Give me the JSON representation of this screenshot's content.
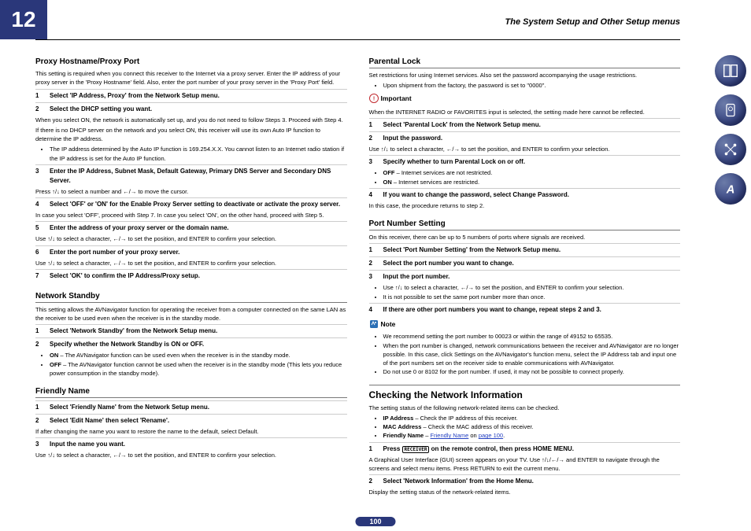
{
  "chapter_number": "12",
  "breadcrumb": "The System Setup and Other Setup menus",
  "page_number": "100",
  "left": {
    "proxy": {
      "title": "Proxy Hostname/Proxy Port",
      "intro": "This setting is required when you connect this receiver to the Internet via a proxy server. Enter the IP address of your proxy server in the 'Proxy Hostname' field. Also, enter the port number of your proxy server in the 'Proxy Port' field.",
      "s1": "Select 'IP Address, Proxy' from the Network Setup menu.",
      "s2": "Select the DHCP setting you want.",
      "s2n1": "When you select ON, the network is automatically set up, and you do not need to follow Steps 3. Proceed with Step 4.",
      "s2n2": "If there is no DHCP server on the network and you select ON, this receiver will use its own Auto IP function to determine the IP address.",
      "s2b": "The IP address determined by the Auto IP function is 169.254.X.X. You cannot listen to an Internet radio station if the IP address is set for the Auto IP function.",
      "s3": "Enter the IP Address, Subnet Mask, Default Gateway, Primary DNS Server and Secondary DNS Server.",
      "s3n": "Press ↑/↓ to select a number and ←/→ to move the cursor.",
      "s4": "Select 'OFF' or 'ON' for the Enable Proxy Server setting to deactivate or activate the proxy server.",
      "s4n": "In case you select 'OFF', proceed with Step 7. In case you select 'ON', on the other hand, proceed with Step 5.",
      "s5": "Enter the address of your proxy server or the domain name.",
      "s5n": "Use ↑/↓ to select a character, ←/→ to set the position, and ENTER to confirm your selection.",
      "s6": "Enter the port number of your proxy server.",
      "s6n": "Use ↑/↓ to select a character, ←/→ to set the position, and ENTER to confirm your selection.",
      "s7": "Select 'OK' to confirm the IP Address/Proxy setup."
    },
    "standby": {
      "title": "Network Standby",
      "intro": "This setting allows the AVNavigator function for operating the receiver from a computer connected on the same LAN as the receiver to be used even when the receiver is in the standby mode.",
      "s1": "Select 'Network Standby' from the Network Setup menu.",
      "s2": "Specify whether the Network Standby is ON or OFF.",
      "b1_label": "ON",
      "b1_text": " – The AVNavigator function can be used even when the receiver is in the standby mode.",
      "b2_label": "OFF",
      "b2_text": " – The AVNavigator function cannot be used when the receiver is in the standby mode (This lets you reduce power consumption in the standby mode)."
    },
    "friendly": {
      "title": "Friendly Name",
      "s1": "Select 'Friendly Name' from the Network Setup menu.",
      "s2": "Select 'Edit Name' then select 'Rename'.",
      "s2n": "If after changing the name you want to restore the name to the default, select Default.",
      "s3": "Input the name you want.",
      "s3n": "Use ↑/↓ to select a character, ←/→ to set the position, and ENTER to confirm your selection."
    }
  },
  "right": {
    "parental": {
      "title": "Parental Lock",
      "intro": "Set restrictions for using Internet services. Also set the password accompanying the usage restrictions.",
      "b0": "Upon shipment from the factory, the password is set to \"0000\".",
      "imp_label": "Important",
      "imp_text": "When the INTERNET RADIO or FAVORITES input is selected, the setting made here cannot be reflected.",
      "s1": "Select 'Parental Lock' from the Network Setup menu.",
      "s2": "Input the password.",
      "s2n": "Use ↑/↓ to select a character, ←/→ to set the position, and ENTER to confirm your selection.",
      "s3": "Specify whether to turn Parental Lock on or off.",
      "b1_label": "OFF",
      "b1_text": " – Internet services are not restricted.",
      "b2_label": "ON",
      "b2_text": " – Internet services are restricted.",
      "s4": "If you want to change the password, select Change Password.",
      "s4n": "In this case, the procedure returns to step 2."
    },
    "port": {
      "title": "Port Number Setting",
      "intro": "On this receiver, there can be up to 5 numbers of ports where signals are received.",
      "s1": "Select 'Port Number Setting' from the Network Setup menu.",
      "s2": "Select the port number you want to change.",
      "s3": "Input the port number.",
      "b3a": "Use ↑/↓ to select a character, ←/→ to set the position, and ENTER to confirm your selection.",
      "b3b": "It is not possible to set the same port number more than once.",
      "s4": "If there are other port numbers you want to change, repeat steps 2 and 3.",
      "note_label": "Note",
      "nb1": "We recommend setting the port number to 00023 or within the range of 49152 to 65535.",
      "nb2": "When the port number is changed, network communications between the receiver and AVNavigator are no longer possible. In this case, click Settings on the AVNavigator's function menu, select the IP Address tab and input one of the port numbers set on the receiver side to enable communications with AVNavigator.",
      "nb3": "Do not use 0 or 8102 for the port number. If used, it may not be possible to connect properly."
    },
    "netinfo": {
      "title": "Checking the Network Information",
      "intro": "The setting status of the following network-related items can be checked.",
      "ip_label": "IP Address",
      "ip_text": " – Check the IP address of this receiver.",
      "mac_label": "MAC Address",
      "mac_text": " – Check the MAC address of this receiver.",
      "fn_label": "Friendly Name",
      "fn_dash": " – ",
      "fn_link": "Friendly Name",
      "fn_on": " on ",
      "fn_page_link": "page 100",
      "fn_end": ".",
      "s1_pre": "Press ",
      "s1_btn": "RECEIVER",
      "s1_post": " on the remote control, then press HOME MENU.",
      "s1n": "A Graphical User Interface (GUI) screen appears on your TV. Use ↑/↓/←/→ and ENTER to navigate through the screens and select menu items. Press RETURN to exit the current menu.",
      "s2": "Select 'Network Information' from the Home Menu.",
      "s2n": "Display the setting status of the network-related items."
    }
  }
}
